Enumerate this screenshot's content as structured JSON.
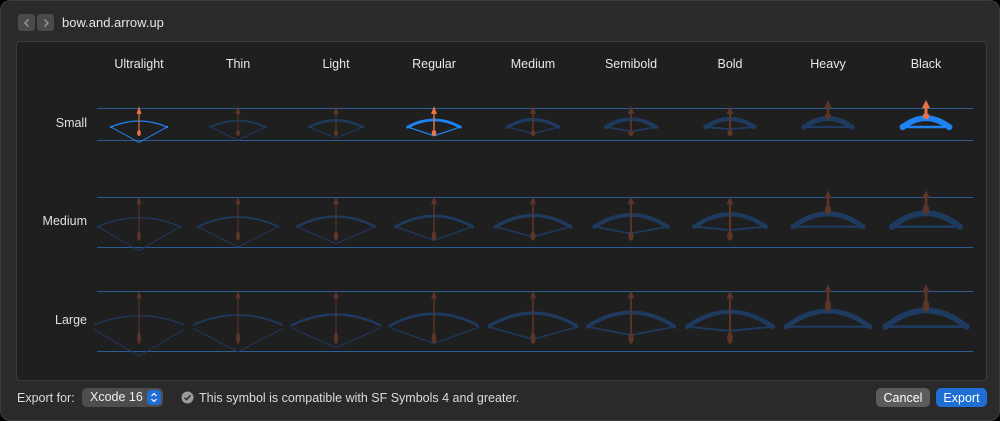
{
  "window": {
    "title": "bow.and.arrow.up"
  },
  "grid": {
    "weights": [
      "Ultralight",
      "Thin",
      "Light",
      "Regular",
      "Medium",
      "Semibold",
      "Bold",
      "Heavy",
      "Black"
    ],
    "scales": [
      "Small",
      "Medium",
      "Large"
    ],
    "highlighted": [
      {
        "scale": "Small",
        "weight": "Ultralight"
      },
      {
        "scale": "Small",
        "weight": "Regular"
      },
      {
        "scale": "Small",
        "weight": "Black"
      }
    ],
    "colors": {
      "bow_active": "#1f82f0",
      "bow_dim": "#1e3a5f",
      "arrow_active": "#e8734a",
      "arrow_dim": "#5a3528",
      "guide": "#2c5d92"
    }
  },
  "footer": {
    "export_label": "Export for:",
    "export_target": "Xcode 16",
    "compat_icon": "checkmark-circle-icon",
    "compat_text": "This symbol is compatible with SF Symbols 4 and greater.",
    "cancel_label": "Cancel",
    "export_label_btn": "Export"
  }
}
